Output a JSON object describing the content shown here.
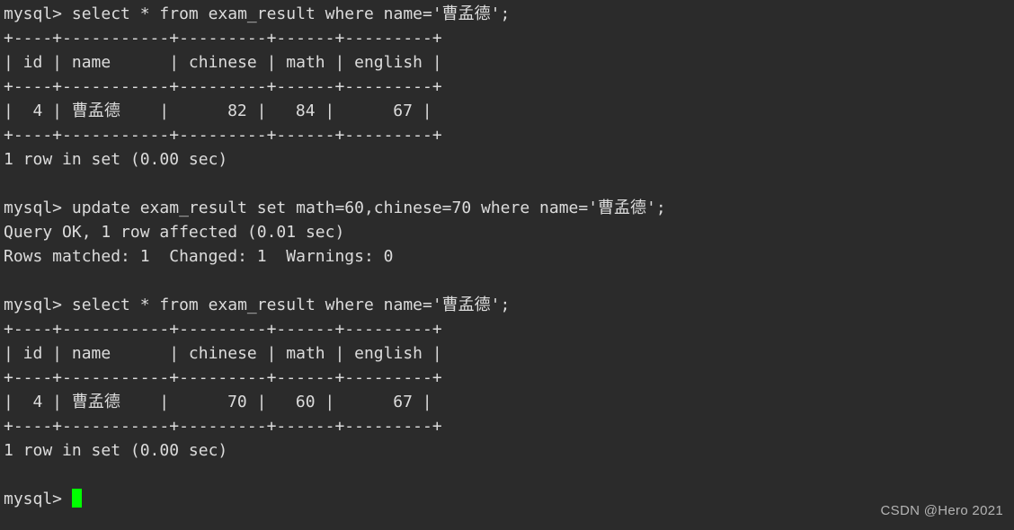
{
  "terminal": {
    "background_color": "#2b2b2b",
    "text_color": "#dcdcdc",
    "cursor_color": "#00ff00",
    "prompt": "mysql>",
    "lines": [
      {
        "id": "cmd-select-1",
        "text": "mysql> select * from exam_result where name='曹孟德';"
      },
      {
        "id": "sep-top-1",
        "text": "+----+-----------+---------+------+---------+"
      },
      {
        "id": "header-1",
        "text": "| id | name      | chinese | math | english |"
      },
      {
        "id": "sep-mid-1",
        "text": "+----+-----------+---------+------+---------+"
      },
      {
        "id": "row-1",
        "text": "|  4 | 曹孟德    |      82 |   84 |      67 |"
      },
      {
        "id": "sep-bot-1",
        "text": "+----+-----------+---------+------+---------+"
      },
      {
        "id": "result-1",
        "text": "1 row in set (0.00 sec)"
      },
      {
        "id": "blank-1",
        "text": ""
      },
      {
        "id": "cmd-update",
        "text": "mysql> update exam_result set math=60,chinese=70 where name='曹孟德';"
      },
      {
        "id": "query-ok",
        "text": "Query OK, 1 row affected (0.01 sec)"
      },
      {
        "id": "rows-matched",
        "text": "Rows matched: 1  Changed: 1  Warnings: 0"
      },
      {
        "id": "blank-2",
        "text": ""
      },
      {
        "id": "cmd-select-2",
        "text": "mysql> select * from exam_result where name='曹孟德';"
      },
      {
        "id": "sep-top-2",
        "text": "+----+-----------+---------+------+---------+"
      },
      {
        "id": "header-2",
        "text": "| id | name      | chinese | math | english |"
      },
      {
        "id": "sep-mid-2",
        "text": "+----+-----------+---------+------+---------+"
      },
      {
        "id": "row-2",
        "text": "|  4 | 曹孟德    |      70 |   60 |      67 |"
      },
      {
        "id": "sep-bot-2",
        "text": "+----+-----------+---------+------+---------+"
      },
      {
        "id": "result-2",
        "text": "1 row in set (0.00 sec)"
      },
      {
        "id": "blank-3",
        "text": ""
      },
      {
        "id": "prompt-active",
        "text": "mysql> ",
        "cursor": true
      }
    ],
    "tables": [
      {
        "id": "table-before-update",
        "columns": [
          "id",
          "name",
          "chinese",
          "math",
          "english"
        ],
        "rows": [
          [
            "4",
            "曹孟德",
            "82",
            "84",
            "67"
          ]
        ],
        "footer": "1 row in set (0.00 sec)"
      },
      {
        "id": "table-after-update",
        "columns": [
          "id",
          "name",
          "chinese",
          "math",
          "english"
        ],
        "rows": [
          [
            "4",
            "曹孟德",
            "70",
            "60",
            "67"
          ]
        ],
        "footer": "1 row in set (0.00 sec)"
      }
    ]
  },
  "watermark": {
    "text": "CSDN @Hero 2021"
  }
}
